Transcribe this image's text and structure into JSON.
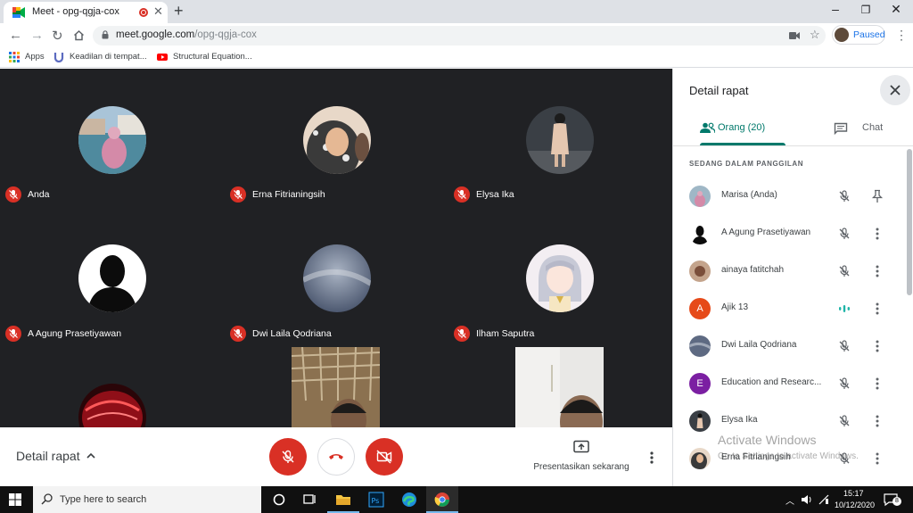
{
  "browser": {
    "tab_title": "Meet - opg-qgja-cox",
    "url_host": "meet.google.com",
    "url_path": "/opg-qgja-cox",
    "profile_label": "Paused",
    "bookmarks": [
      "Apps",
      "Keadilan di tempat...",
      "Structural Equation..."
    ]
  },
  "tiles": [
    {
      "name": "Anda"
    },
    {
      "name": "Erna Fitrianingsih"
    },
    {
      "name": "Elysa Ika"
    },
    {
      "name": "A Agung Prasetiyawan"
    },
    {
      "name": "Dwi Laila Qodriana"
    },
    {
      "name": "Ilham Saputra"
    }
  ],
  "controls": {
    "details_label": "Detail rapat",
    "present_label": "Presentasikan sekarang"
  },
  "panel": {
    "title": "Detail rapat",
    "people_tab": "Orang (20)",
    "chat_tab": "Chat",
    "section_heading": "SEDANG DALAM PANGGILAN",
    "people": [
      {
        "name": "Marisa (Anda)"
      },
      {
        "name": "A Agung Prasetiyawan"
      },
      {
        "name": "ainaya fatitchah"
      },
      {
        "name": "Ajik 13",
        "initial": "A"
      },
      {
        "name": "Dwi Laila Qodriana"
      },
      {
        "name": "Education and Researc...",
        "initial": "E"
      },
      {
        "name": "Elysa Ika"
      },
      {
        "name": "Erna Fitrianingsih"
      }
    ],
    "watermark_line1": "Activate Windows",
    "watermark_line2": "Go to Settings to activate Windows."
  },
  "taskbar": {
    "search_placeholder": "Type here to search",
    "time": "15:17",
    "date": "10/12/2020",
    "notification_count": "8"
  },
  "colors": {
    "stage_bg": "#202124",
    "mic_off_red": "#d93025",
    "accent_teal": "#00796b",
    "avatar_ajik": "#e64a19",
    "avatar_education": "#7b1fa2"
  }
}
